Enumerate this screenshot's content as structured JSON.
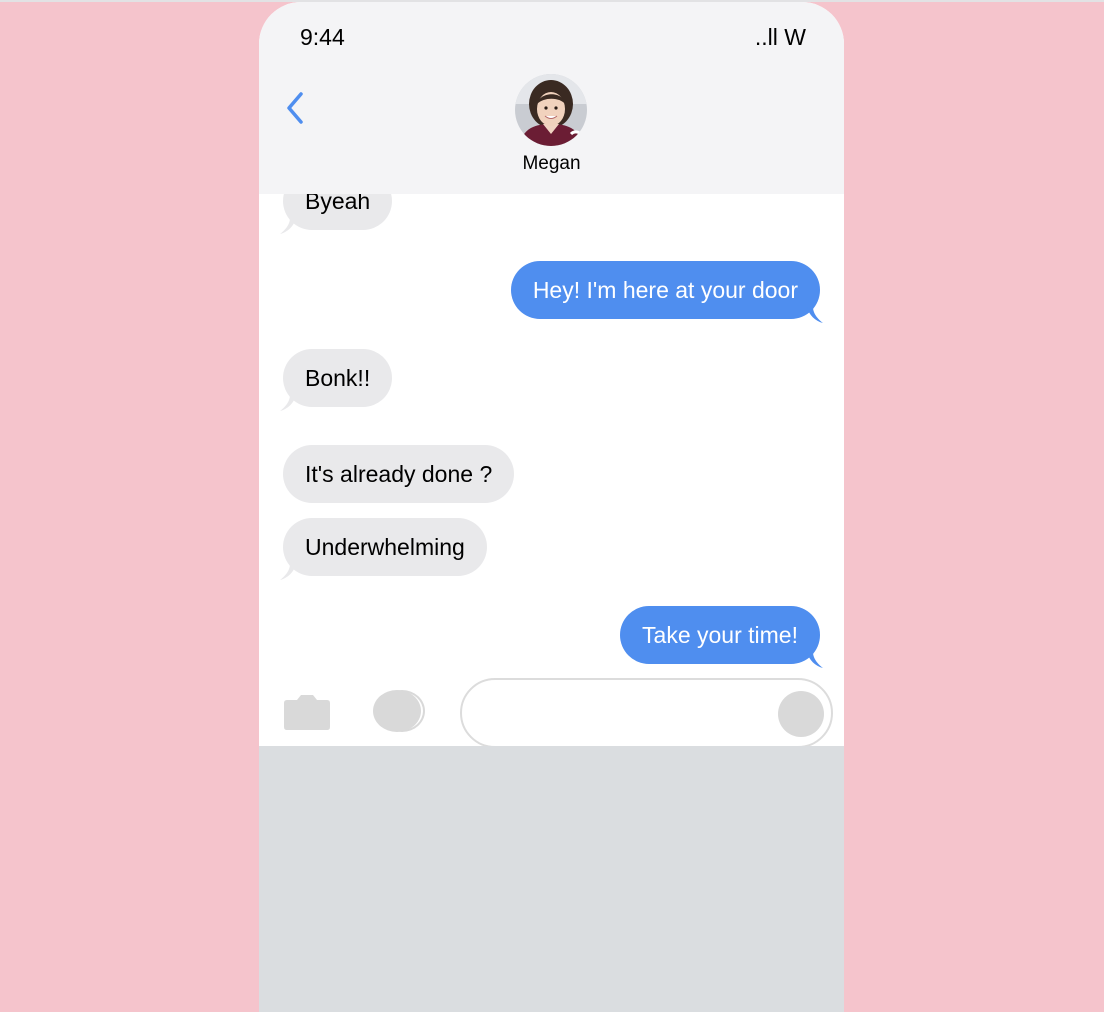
{
  "status_bar": {
    "time": "9:44",
    "signal": "..ll W"
  },
  "header": {
    "contact_name": "Megan",
    "back_icon": "chevron-left-icon",
    "avatar_icon": "contact-avatar-photo"
  },
  "messages": [
    {
      "direction": "in",
      "text": "Byeah"
    },
    {
      "direction": "out",
      "text": "Hey! I'm here at your door"
    },
    {
      "direction": "in",
      "text": "Bonk!!"
    },
    {
      "direction": "in",
      "text": "It's already done ?"
    },
    {
      "direction": "in",
      "text": "Underwhelming"
    },
    {
      "direction": "out",
      "text": "Take your time!"
    }
  ],
  "composer": {
    "camera_icon": "camera-icon",
    "apps_icon": "app-store-icon",
    "input_value": "",
    "send_icon": "send-icon"
  },
  "colors": {
    "background": "#f5c4cc",
    "header_bg": "#f4f4f6",
    "incoming_bubble": "#e9e9eb",
    "outgoing_bubble": "#4f8eef",
    "back_chevron": "#4f8eef",
    "keyboard_area": "#dadde0"
  }
}
